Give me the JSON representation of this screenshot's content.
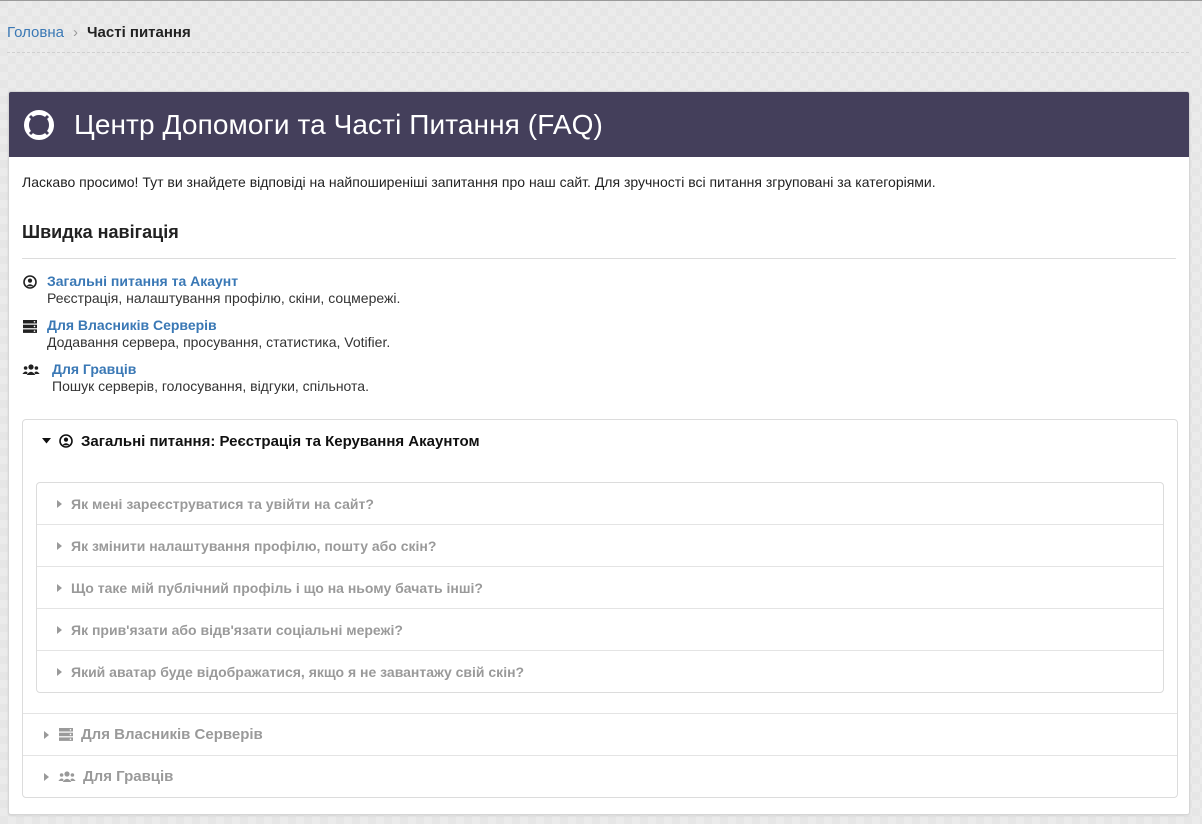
{
  "breadcrumb": {
    "home": "Головна",
    "separator": "›",
    "current": "Часті питання"
  },
  "header": {
    "icon": "life-ring-icon",
    "title": "Центр Допомоги та Часті Питання (FAQ)",
    "background": "#443f5b"
  },
  "intro": "Ласкаво просимо! Тут ви знайдете відповіді на найпоширеніші запитання про наш сайт. Для зручності всі питання згруповані за категоріями.",
  "quick_nav": {
    "title": "Швидка навігація",
    "items": [
      {
        "icon": "user-circle-icon",
        "label": "Загальні питання та Акаунт",
        "desc": "Реєстрація, налаштування профілю, скіни, соцмережі."
      },
      {
        "icon": "server-icon",
        "label": "Для Власників Серверів",
        "desc": "Додавання сервера, просування, статистика, Votifier."
      },
      {
        "icon": "users-icon",
        "label": "Для Гравців",
        "desc": "Пошук серверів, голосування, відгуки, спільнота."
      }
    ]
  },
  "sections": [
    {
      "icon": "user-circle-icon",
      "title": "Загальні питання: Реєстрація та Керування Акаунтом",
      "expanded": true,
      "questions": [
        "Як мені зареєструватися та увійти на сайт?",
        "Як змінити налаштування профілю, пошту або скін?",
        "Що таке мій публічний профіль і що на ньому бачать інші?",
        "Як прив'язати або відв'язати соціальні мережі?",
        "Який аватар буде відображатися, якщо я не завантажу свій скін?"
      ]
    },
    {
      "icon": "server-icon",
      "title": "Для Власників Серверів",
      "expanded": false
    },
    {
      "icon": "users-icon",
      "title": "Для Гравців",
      "expanded": false
    }
  ],
  "colors": {
    "link": "#3a78b5",
    "muted": "#9a9a9a",
    "header_bg": "#443f5b"
  }
}
